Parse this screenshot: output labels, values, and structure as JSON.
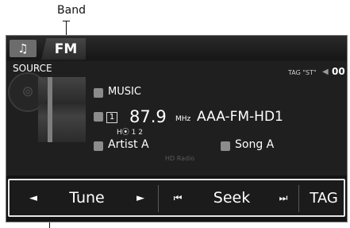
{
  "callout": {
    "band_label": "Band"
  },
  "tabs": {
    "music_icon": "music-note-icon",
    "band": "FM"
  },
  "source": {
    "label": "SOURCE",
    "tag_status": "TAG \"ST\"",
    "volume_icon": "volume-icon",
    "volume": "00"
  },
  "info": {
    "genre": "MUSIC",
    "station_number": "1",
    "frequency": "87.9",
    "unit": "MHz",
    "station_name": "AAA-FM-HD1",
    "hd_channels": "1 2",
    "artist": "Artist A",
    "song": "Song A",
    "hd_radio_logo": "HD Radio"
  },
  "controls": {
    "tune_label": "Tune",
    "seek_label": "Seek",
    "tag_label": "TAG",
    "tune_prev_icon": "◄",
    "tune_next_icon": "►",
    "seek_prev_icon": "⏮",
    "seek_next_icon": "⏭"
  }
}
